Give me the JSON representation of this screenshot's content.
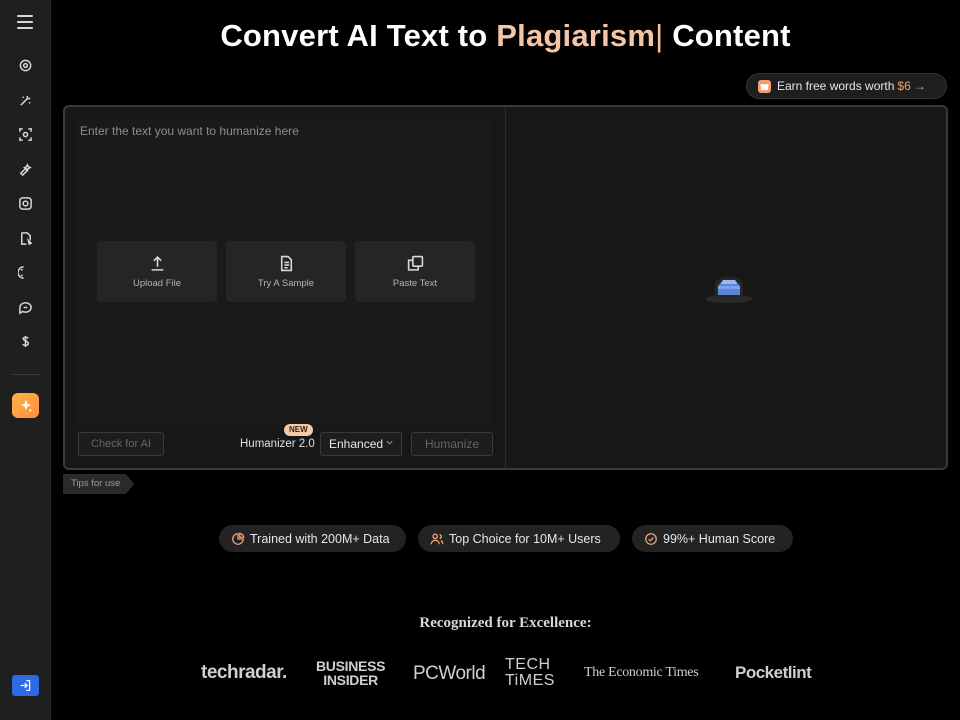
{
  "headline": {
    "prefix": "Convert AI Text to",
    "accent": "Plagiarism",
    "cursor": "|",
    "suffix": "Content"
  },
  "promo": {
    "text": "Earn free words worth",
    "amount": "$6 →"
  },
  "editor": {
    "placeholder": "Enter the text you want to humanize here",
    "quick_actions": [
      {
        "label": "Upload File",
        "icon": "upload-icon"
      },
      {
        "label": "Try A Sample",
        "icon": "document-icon"
      },
      {
        "label": "Paste Text",
        "icon": "copy-icon"
      }
    ],
    "check_ai_label": "Check for AI",
    "model_label": "Humanizer 2.0",
    "new_badge": "NEW",
    "mode_value": "Enhanced",
    "humanize_label": "Humanize"
  },
  "tips_label": "Tips for use",
  "pills": [
    {
      "text": "Trained with 200M+ Data",
      "icon": "chart-icon"
    },
    {
      "text": "Top Choice for 10M+ Users",
      "icon": "users-icon"
    },
    {
      "text": "99%+ Human Score",
      "icon": "check-circle-icon"
    }
  ],
  "recognized": {
    "title": "Recognized for Excellence:",
    "logos": {
      "techradar": "techradar.",
      "business_insider_1": "BUSINESS",
      "business_insider_2": "INSIDER",
      "pcworld": "PCWorld",
      "techtimes_1": "TECH",
      "techtimes_2": "TiMES",
      "economic_times": "The Economic Times",
      "pocketlint": "Pocketlint"
    }
  },
  "colors": {
    "accent": "#f5c6a5",
    "premium": "#ff9a45",
    "login": "#2d6be4"
  }
}
